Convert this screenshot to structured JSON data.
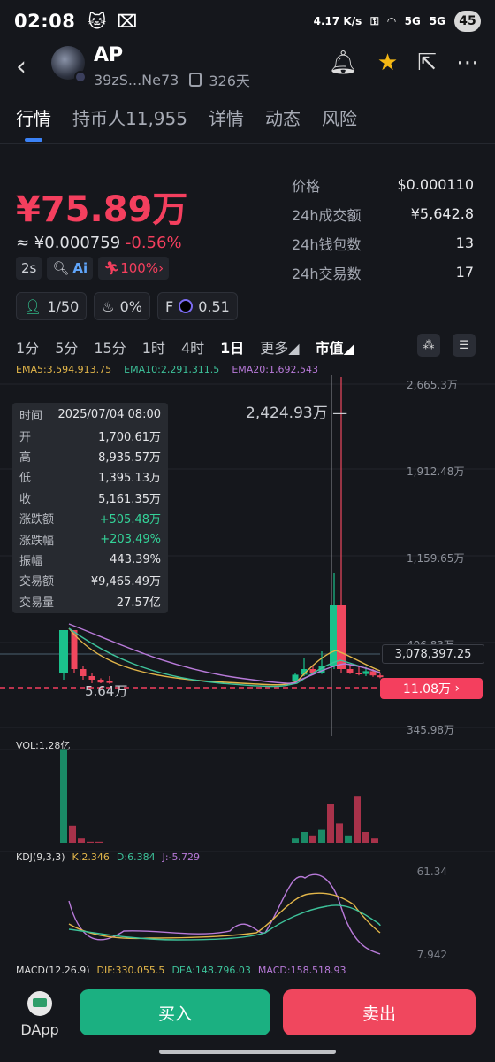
{
  "status": {
    "time": "02:08",
    "speed": "4.17 K/s",
    "net1": "5G",
    "net2": "5G",
    "battery": "45"
  },
  "header": {
    "name": "AP",
    "address": "39zS...Ne73",
    "age": "326天"
  },
  "tabs": [
    "行情",
    "持币人11,955",
    "详情",
    "动态",
    "风险"
  ],
  "price": {
    "mcap": "¥75.89万",
    "approx": "≈ ¥0.000759",
    "change": "-0.56%",
    "interval_chip": "2s",
    "ai_label": "Ai",
    "pct_chip": "100%",
    "holders_chip": "1/50",
    "chef_chip": "0%",
    "f_label": "F",
    "f_value": "0.51"
  },
  "stats": [
    {
      "label": "价格",
      "value": "$0.000110"
    },
    {
      "label": "24h成交额",
      "value": "¥5,642.8"
    },
    {
      "label": "24h钱包数",
      "value": "13"
    },
    {
      "label": "24h交易数",
      "value": "17"
    }
  ],
  "intervals": [
    "1分",
    "5分",
    "15分",
    "1时",
    "4时",
    "1日",
    "更多",
    "市值"
  ],
  "ema": {
    "e5": "EMA5:3,594,913.75",
    "e10": "EMA10:2,291,311.5",
    "e20": "EMA20:1,692,543"
  },
  "tooltip": [
    {
      "k": "时间",
      "v": "2025/07/04 08:00"
    },
    {
      "k": "开",
      "v": "1,700.61万"
    },
    {
      "k": "高",
      "v": "8,935.57万"
    },
    {
      "k": "低",
      "v": "1,395.13万"
    },
    {
      "k": "收",
      "v": "5,161.35万"
    },
    {
      "k": "涨跌额",
      "v": "+505.48万"
    },
    {
      "k": "涨跌幅",
      "v": "+203.49%"
    },
    {
      "k": "振幅",
      "v": "443.39%"
    },
    {
      "k": "交易额",
      "v": "¥9,465.49万"
    },
    {
      "k": "交易量",
      "v": "27.57亿"
    }
  ],
  "chart_data": {
    "type": "candlestick",
    "y_ticks": [
      "2,665.3万",
      "1,912.48万",
      "1,159.65万",
      "406.83万",
      "345.98万"
    ],
    "peak_label": "2,424.93万",
    "low_label": "5.64万",
    "current_marker": "3,078,397.25",
    "last_price_tag": "11.08万",
    "volume_label": "VOL:1.28亿",
    "kdj_label": "KDJ(9,3,3)",
    "kdj_k": "K:2.346",
    "kdj_d": "D:6.384",
    "kdj_j": "J:-5.729",
    "kdj_axis": [
      "61.34",
      "7.942"
    ],
    "macd_label": "MACD(12,26,9)",
    "macd_dif": "DIF:330,055.5",
    "macd_dea": "DEA:148,796.03",
    "macd_val": "MACD:158,518.93",
    "candles": [
      {
        "o": 1,
        "h": 1.6,
        "l": 0.9,
        "c": 1.6,
        "up": true
      },
      {
        "o": 1.6,
        "h": 1.6,
        "l": 1.0,
        "c": 1.05,
        "up": false
      },
      {
        "o": 1.05,
        "h": 1.1,
        "l": 0.9,
        "c": 0.95,
        "up": false
      },
      {
        "o": 0.95,
        "h": 1.0,
        "l": 0.85,
        "c": 0.9,
        "up": false
      },
      {
        "o": 0.9,
        "h": 0.92,
        "l": 0.85,
        "c": 0.86,
        "up": false
      },
      {
        "o": 0.86,
        "h": 0.95,
        "l": 0.84,
        "c": 0.88,
        "up": false
      },
      {
        "o": 0.88,
        "h": 1.0,
        "l": 0.87,
        "c": 0.97,
        "up": true
      },
      {
        "o": 0.97,
        "h": 1.2,
        "l": 0.95,
        "c": 1.05,
        "up": true
      },
      {
        "o": 1.05,
        "h": 1.1,
        "l": 0.98,
        "c": 1.0,
        "up": false
      },
      {
        "o": 1.0,
        "h": 1.3,
        "l": 0.98,
        "c": 1.1,
        "up": true
      },
      {
        "o": 1.1,
        "h": 2.4,
        "l": 1.05,
        "c": 1.95,
        "up": true
      },
      {
        "o": 1.95,
        "h": 4.2,
        "l": 1.0,
        "c": 1.05,
        "up": false
      },
      {
        "o": 1.05,
        "h": 1.12,
        "l": 0.98,
        "c": 1.0,
        "up": false
      },
      {
        "o": 1.0,
        "h": 1.1,
        "l": 0.96,
        "c": 0.98,
        "up": false
      },
      {
        "o": 0.98,
        "h": 1.08,
        "l": 0.95,
        "c": 1.02,
        "up": true
      },
      {
        "o": 1.02,
        "h": 1.05,
        "l": 0.94,
        "c": 0.96,
        "up": false
      },
      {
        "o": 0.96,
        "h": 1.0,
        "l": 0.92,
        "c": 0.94,
        "up": false
      }
    ],
    "volumes": [
      88,
      16,
      4,
      1,
      1,
      0,
      0,
      0,
      0,
      0,
      0,
      0,
      4,
      10,
      6,
      12,
      36,
      18,
      6,
      44,
      10,
      4
    ]
  },
  "buttons": {
    "dapp": "DApp",
    "buy": "买入",
    "sell": "卖出"
  }
}
